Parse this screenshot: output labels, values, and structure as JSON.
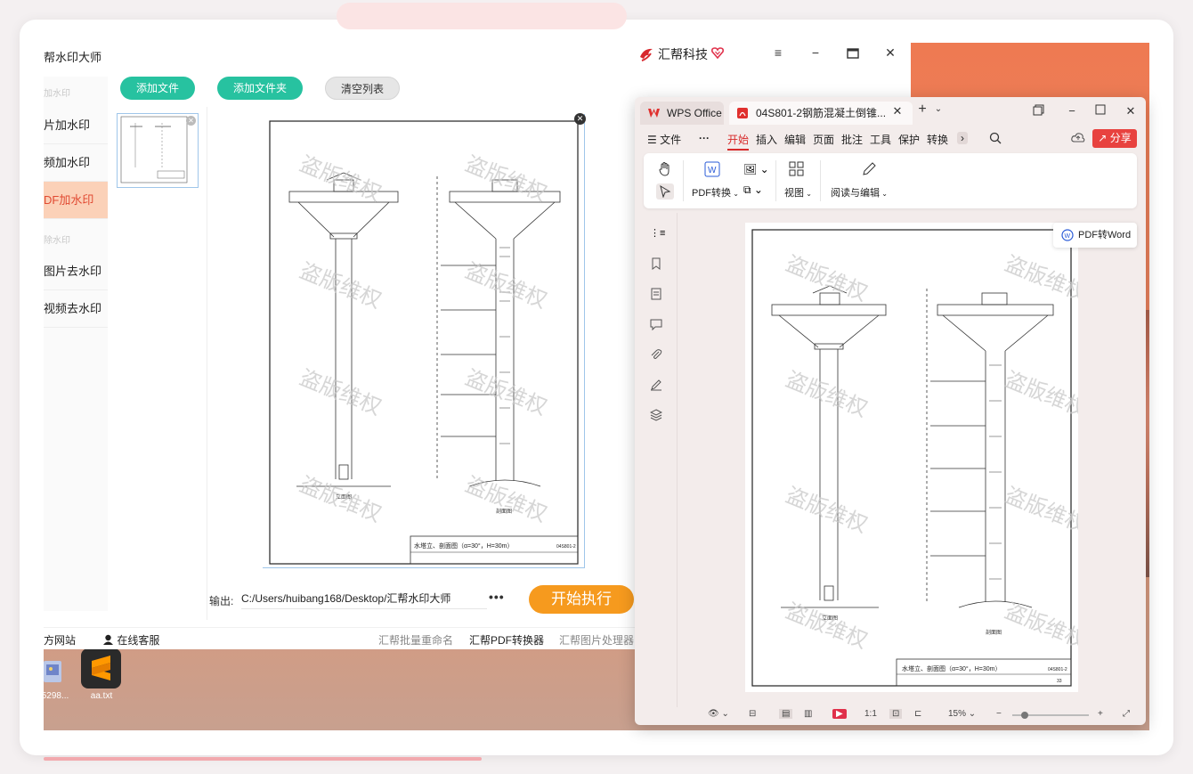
{
  "app": {
    "title": "帮水印大师",
    "brand": "汇帮科技",
    "sidebar": {
      "cat1": "加水印",
      "items1": [
        "片加水印",
        "频加水印",
        "DF加水印"
      ],
      "cat2": "除水印",
      "items2": [
        "图片去水印",
        "视频去水印"
      ]
    },
    "toolbar": {
      "add_file": "添加文件",
      "add_folder": "添加文件夹",
      "clear_list": "清空列表"
    },
    "output": {
      "label": "输出:",
      "path": "C:/Users/huibang168/Desktop/汇帮水印大师",
      "more": "•••"
    },
    "start_label": "开始执行",
    "footer": {
      "website": "方网站",
      "support": "在线客服",
      "links": [
        "汇帮批量重命名",
        "汇帮PDF转换器",
        "汇帮图片处理器"
      ]
    },
    "watermark_text": "盗版维权",
    "icons": {
      "close": "close-icon",
      "menu": "menu-icon",
      "minimize": "minimize-icon",
      "maximize": "maximize-icon"
    }
  },
  "desktop": {
    "icons": [
      {
        "label": "529‪8..."
      },
      {
        "label": "aa.txt"
      }
    ]
  },
  "wps": {
    "tabs": {
      "home": "WPS Office",
      "doc": "04S801-2钢筋混凝土倒锥..."
    },
    "menu": [
      "文件",
      "开始",
      "插入",
      "编辑",
      "页面",
      "批注",
      "工具",
      "保护",
      "转换"
    ],
    "share": "分享",
    "ribbon": {
      "pdf_convert": "PDF转换",
      "view": "视图",
      "read_edit": "阅读与编辑"
    },
    "tooltip": "PDF转Word",
    "status": {
      "zoom": "15%"
    },
    "accent": "#d72a2a"
  },
  "drawing": {
    "title_block": "水塔立、剖面图（α=30°，H=30m）",
    "caption_left": "立面图",
    "caption_right": "剖面图",
    "sheet_no": "04S801-2",
    "page_no": "33"
  }
}
